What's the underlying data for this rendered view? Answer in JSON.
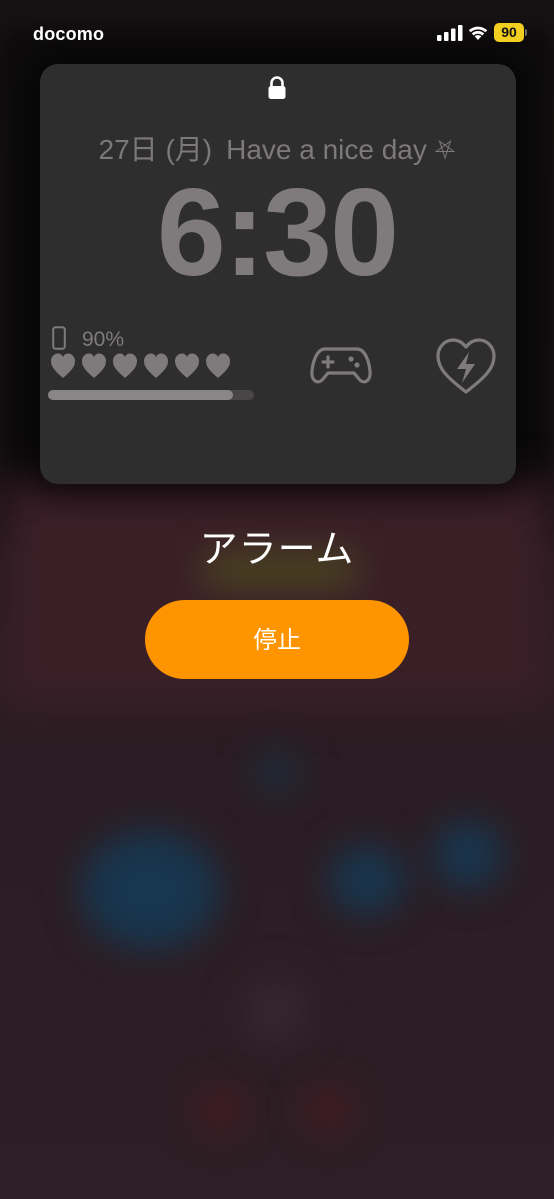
{
  "status_bar": {
    "carrier": "docomo",
    "signal_icon": "signal-bars-icon",
    "wifi_icon": "wifi-icon",
    "battery_level": "90",
    "battery_color": "#f2cf1e"
  },
  "lock_screen": {
    "lock_icon": "lock-icon",
    "date": "27日 (月)",
    "greeting": "Have a nice day",
    "greeting_symbol": "⛧",
    "time": "6:30"
  },
  "widget": {
    "phone_icon": "phone-icon",
    "battery_percent": "90%",
    "hearts_count": 6,
    "hp_fraction": 0.9,
    "gamepad_icon": "gamepad-icon",
    "heart_bolt_icon": "heart-lightning-icon"
  },
  "alarm": {
    "title": "アラーム",
    "stop_label": "停止",
    "accent_color": "#fe9500"
  }
}
